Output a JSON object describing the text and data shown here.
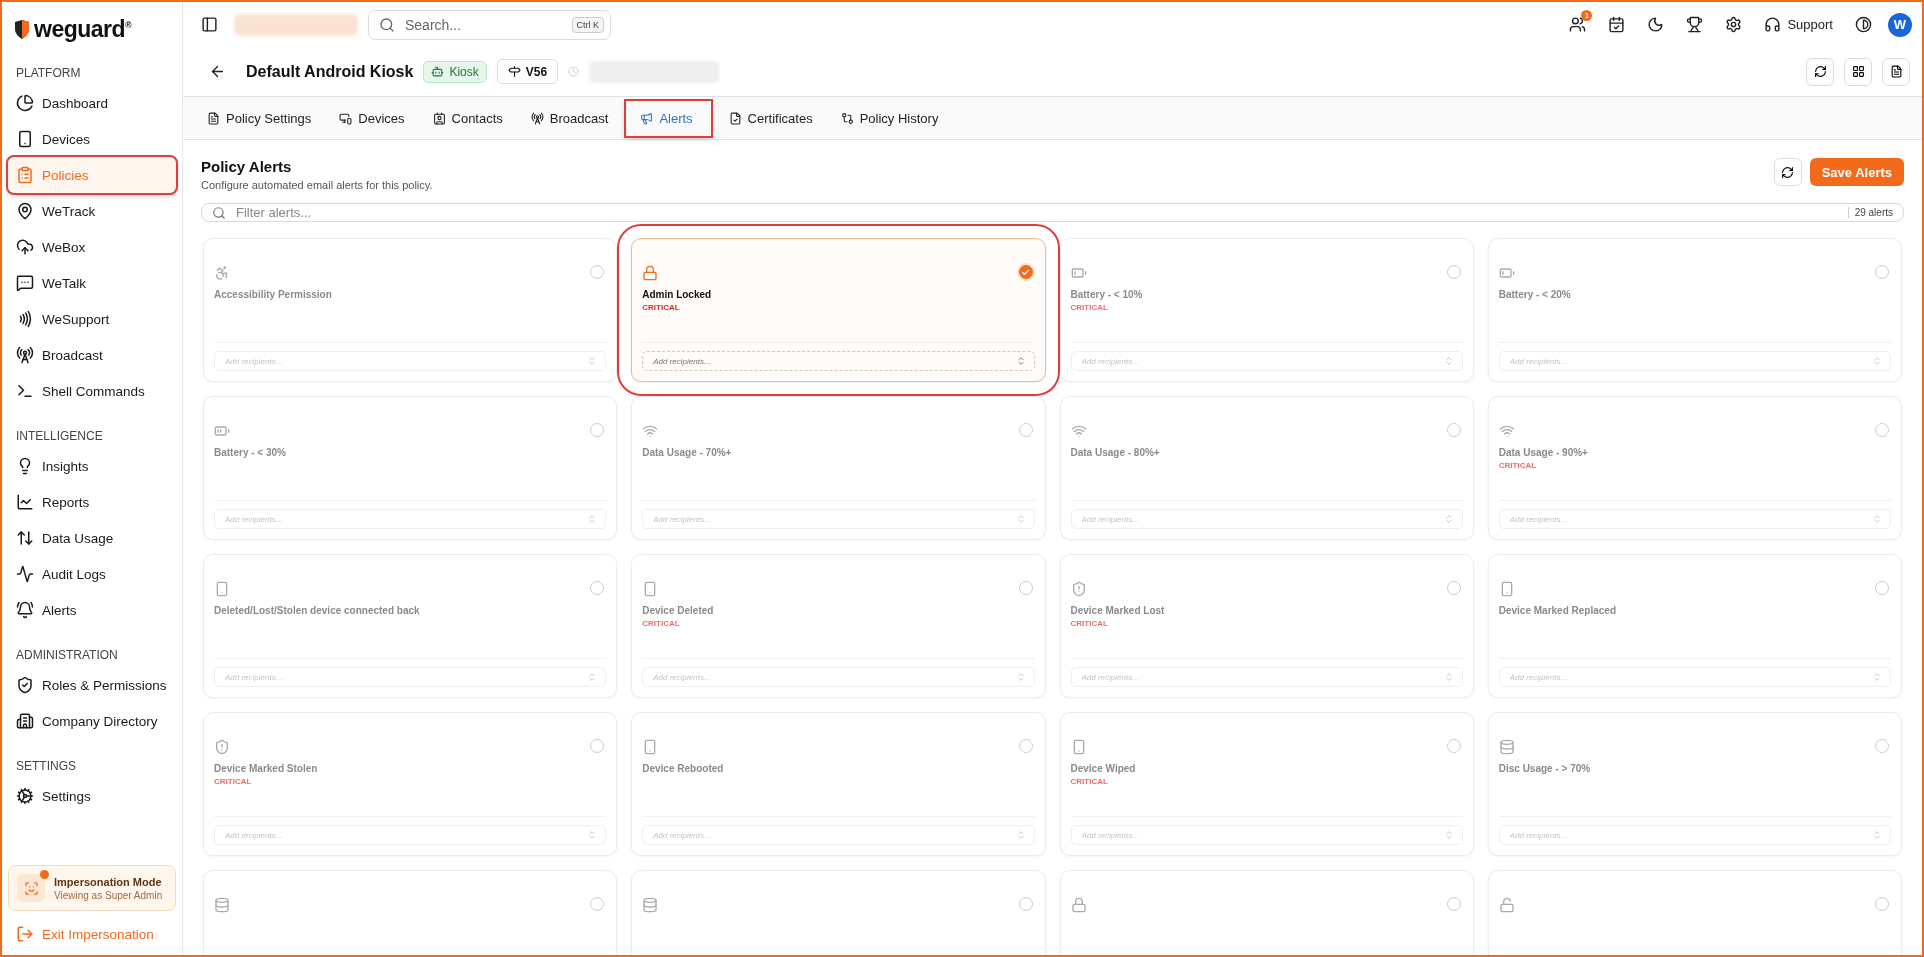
{
  "topbar": {
    "search_placeholder": "Search...",
    "shortcut": "Ctrl K",
    "notification_count": "1",
    "support": "Support",
    "avatar": "W"
  },
  "sidebar": {
    "logo": "weguard$^{®}$",
    "sections": [
      {
        "title": "PLATFORM",
        "items": [
          {
            "label": "Dashboard",
            "selected": false,
            "highlighted": false
          },
          {
            "label": "Devices",
            "selected": false,
            "highlighted": false
          },
          {
            "label": "Policies",
            "selected": true,
            "highlighted": true
          },
          {
            "label": "WeTrack",
            "selected": false,
            "highlighted": false
          },
          {
            "label": "WeBox",
            "selected": false,
            "highlighted": false
          },
          {
            "label": "WeTalk",
            "selected": false,
            "highlighted": false
          },
          {
            "label": "WeSupport",
            "selected": false,
            "highlighted": false
          },
          {
            "label": "Broadcast",
            "selected": false,
            "highlighted": false
          },
          {
            "label": "Shell Commands",
            "selected": false,
            "highlighted": false
          }
        ]
      },
      {
        "title": "INTELLIGENCE",
        "items": [
          {
            "label": "Insights",
            "selected": false,
            "highlighted": false
          },
          {
            "label": "Reports",
            "selected": false,
            "highlighted": false
          },
          {
            "label": "Data Usage",
            "selected": false,
            "highlighted": false
          },
          {
            "label": "Audit Logs",
            "selected": false,
            "highlighted": false
          },
          {
            "label": "Alerts",
            "selected": false,
            "highlighted": false
          }
        ]
      },
      {
        "title": "ADMINISTRATION",
        "items": [
          {
            "label": "Roles & Permissions",
            "selected": false,
            "highlighted": false
          },
          {
            "label": "Company Directory",
            "selected": false,
            "highlighted": false
          }
        ]
      },
      {
        "title": "SETTINGS",
        "items": [
          {
            "label": "Settings",
            "selected": false,
            "highlighted": false
          }
        ]
      }
    ],
    "impersonation": {
      "title": "Impersonation Mode",
      "subtitle": "Viewing as Super Admin"
    },
    "exit": "Exit Impersonation"
  },
  "header": {
    "title": "Default Android Kiosk",
    "badge": "Kiosk",
    "version": "V56"
  },
  "tabs": [
    {
      "label": "Policy Settings",
      "selected": false,
      "highlighted": false
    },
    {
      "label": "Devices",
      "selected": false,
      "highlighted": false
    },
    {
      "label": "Contacts",
      "selected": false,
      "highlighted": false
    },
    {
      "label": "Broadcast",
      "selected": false,
      "highlighted": false
    },
    {
      "label": "Alerts",
      "selected": true,
      "highlighted": true
    },
    {
      "label": "Certificates",
      "selected": false,
      "highlighted": false
    },
    {
      "label": "Policy History",
      "selected": false,
      "highlighted": false
    }
  ],
  "alerts": {
    "title": "Policy Alerts",
    "subtitle": "Configure automated email alerts for this policy.",
    "save": "Save Alerts",
    "filter_placeholder": "Filter alerts...",
    "count": "29 alerts",
    "cards": [
      {
        "kind": "accessibility",
        "name": "Accessibility Permission",
        "selected": false,
        "highlighted": false,
        "placeholder": "Add recipients..."
      },
      {
        "kind": "lock",
        "name": "Admin Locked",
        "severity": "CRITICAL",
        "selected": true,
        "highlighted": true,
        "placeholder": "Add recipients..."
      },
      {
        "kind": "battery-low",
        "name": "Battery - < 10%",
        "severity": "CRITICAL",
        "selected": false,
        "highlighted": false,
        "placeholder": "Add recipients..."
      },
      {
        "kind": "battery-low",
        "name": "Battery - < 20%",
        "selected": false,
        "highlighted": false,
        "placeholder": "Add recipients..."
      },
      {
        "kind": "battery-mid",
        "name": "Battery - < 30%",
        "selected": false,
        "highlighted": false,
        "placeholder": "Add recipients..."
      },
      {
        "kind": "wifi",
        "name": "Data Usage - 70%+",
        "selected": false,
        "highlighted": false,
        "placeholder": "Add recipients..."
      },
      {
        "kind": "wifi",
        "name": "Data Usage - 80%+",
        "selected": false,
        "highlighted": false,
        "placeholder": "Add recipients..."
      },
      {
        "kind": "wifi",
        "name": "Data Usage - 90%+",
        "severity": "CRITICAL",
        "selected": false,
        "highlighted": false,
        "placeholder": "Add recipients..."
      },
      {
        "kind": "phone",
        "name": "Deleted/Lost/Stolen device connected back",
        "selected": false,
        "highlighted": false,
        "placeholder": "Add recipients..."
      },
      {
        "kind": "phone",
        "name": "Device Deleted",
        "severity": "CRITICAL",
        "selected": false,
        "highlighted": false,
        "placeholder": "Add recipients..."
      },
      {
        "kind": "shield",
        "name": "Device Marked Lost",
        "severity": "CRITICAL",
        "selected": false,
        "highlighted": false,
        "placeholder": "Add recipients..."
      },
      {
        "kind": "phone",
        "name": "Device Marked Replaced",
        "selected": false,
        "highlighted": false,
        "placeholder": "Add recipients..."
      },
      {
        "kind": "shield",
        "name": "Device Marked Stolen",
        "severity": "CRITICAL",
        "selected": false,
        "highlighted": false,
        "placeholder": "Add recipients..."
      },
      {
        "kind": "phone",
        "name": "Device Rebooted",
        "selected": false,
        "highlighted": false,
        "placeholder": "Add recipients..."
      },
      {
        "kind": "phone",
        "name": "Device Wiped",
        "severity": "CRITICAL",
        "selected": false,
        "highlighted": false,
        "placeholder": "Add recipients..."
      },
      {
        "kind": "database",
        "name": "Disc Usage - > 70%",
        "selected": false,
        "highlighted": false,
        "placeholder": "Add recipients..."
      },
      {
        "kind": "database",
        "selected": false,
        "highlighted": false
      },
      {
        "kind": "database",
        "selected": false,
        "highlighted": false
      },
      {
        "kind": "lock",
        "selected": false,
        "highlighted": false
      },
      {
        "kind": "unlock",
        "selected": false,
        "highlighted": false
      }
    ]
  }
}
